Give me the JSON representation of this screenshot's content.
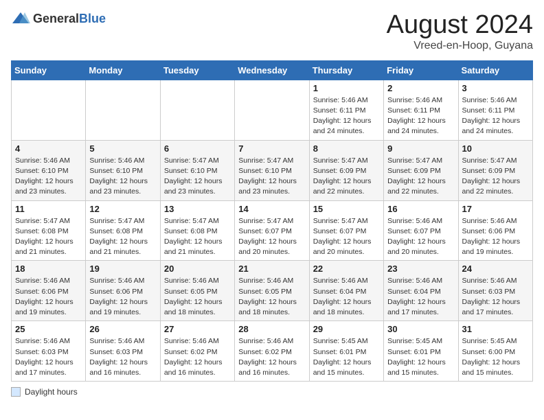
{
  "header": {
    "logo_general": "General",
    "logo_blue": "Blue",
    "month_year": "August 2024",
    "location": "Vreed-en-Hoop, Guyana"
  },
  "footer": {
    "daylight_label": "Daylight hours"
  },
  "days_of_week": [
    "Sunday",
    "Monday",
    "Tuesday",
    "Wednesday",
    "Thursday",
    "Friday",
    "Saturday"
  ],
  "weeks": [
    [
      {
        "day": "",
        "info": ""
      },
      {
        "day": "",
        "info": ""
      },
      {
        "day": "",
        "info": ""
      },
      {
        "day": "",
        "info": ""
      },
      {
        "day": "1",
        "info": "Sunrise: 5:46 AM\nSunset: 6:11 PM\nDaylight: 12 hours\nand 24 minutes."
      },
      {
        "day": "2",
        "info": "Sunrise: 5:46 AM\nSunset: 6:11 PM\nDaylight: 12 hours\nand 24 minutes."
      },
      {
        "day": "3",
        "info": "Sunrise: 5:46 AM\nSunset: 6:11 PM\nDaylight: 12 hours\nand 24 minutes."
      }
    ],
    [
      {
        "day": "4",
        "info": "Sunrise: 5:46 AM\nSunset: 6:10 PM\nDaylight: 12 hours\nand 23 minutes."
      },
      {
        "day": "5",
        "info": "Sunrise: 5:46 AM\nSunset: 6:10 PM\nDaylight: 12 hours\nand 23 minutes."
      },
      {
        "day": "6",
        "info": "Sunrise: 5:47 AM\nSunset: 6:10 PM\nDaylight: 12 hours\nand 23 minutes."
      },
      {
        "day": "7",
        "info": "Sunrise: 5:47 AM\nSunset: 6:10 PM\nDaylight: 12 hours\nand 23 minutes."
      },
      {
        "day": "8",
        "info": "Sunrise: 5:47 AM\nSunset: 6:09 PM\nDaylight: 12 hours\nand 22 minutes."
      },
      {
        "day": "9",
        "info": "Sunrise: 5:47 AM\nSunset: 6:09 PM\nDaylight: 12 hours\nand 22 minutes."
      },
      {
        "day": "10",
        "info": "Sunrise: 5:47 AM\nSunset: 6:09 PM\nDaylight: 12 hours\nand 22 minutes."
      }
    ],
    [
      {
        "day": "11",
        "info": "Sunrise: 5:47 AM\nSunset: 6:08 PM\nDaylight: 12 hours\nand 21 minutes."
      },
      {
        "day": "12",
        "info": "Sunrise: 5:47 AM\nSunset: 6:08 PM\nDaylight: 12 hours\nand 21 minutes."
      },
      {
        "day": "13",
        "info": "Sunrise: 5:47 AM\nSunset: 6:08 PM\nDaylight: 12 hours\nand 21 minutes."
      },
      {
        "day": "14",
        "info": "Sunrise: 5:47 AM\nSunset: 6:07 PM\nDaylight: 12 hours\nand 20 minutes."
      },
      {
        "day": "15",
        "info": "Sunrise: 5:47 AM\nSunset: 6:07 PM\nDaylight: 12 hours\nand 20 minutes."
      },
      {
        "day": "16",
        "info": "Sunrise: 5:46 AM\nSunset: 6:07 PM\nDaylight: 12 hours\nand 20 minutes."
      },
      {
        "day": "17",
        "info": "Sunrise: 5:46 AM\nSunset: 6:06 PM\nDaylight: 12 hours\nand 19 minutes."
      }
    ],
    [
      {
        "day": "18",
        "info": "Sunrise: 5:46 AM\nSunset: 6:06 PM\nDaylight: 12 hours\nand 19 minutes."
      },
      {
        "day": "19",
        "info": "Sunrise: 5:46 AM\nSunset: 6:06 PM\nDaylight: 12 hours\nand 19 minutes."
      },
      {
        "day": "20",
        "info": "Sunrise: 5:46 AM\nSunset: 6:05 PM\nDaylight: 12 hours\nand 18 minutes."
      },
      {
        "day": "21",
        "info": "Sunrise: 5:46 AM\nSunset: 6:05 PM\nDaylight: 12 hours\nand 18 minutes."
      },
      {
        "day": "22",
        "info": "Sunrise: 5:46 AM\nSunset: 6:04 PM\nDaylight: 12 hours\nand 18 minutes."
      },
      {
        "day": "23",
        "info": "Sunrise: 5:46 AM\nSunset: 6:04 PM\nDaylight: 12 hours\nand 17 minutes."
      },
      {
        "day": "24",
        "info": "Sunrise: 5:46 AM\nSunset: 6:03 PM\nDaylight: 12 hours\nand 17 minutes."
      }
    ],
    [
      {
        "day": "25",
        "info": "Sunrise: 5:46 AM\nSunset: 6:03 PM\nDaylight: 12 hours\nand 17 minutes."
      },
      {
        "day": "26",
        "info": "Sunrise: 5:46 AM\nSunset: 6:03 PM\nDaylight: 12 hours\nand 16 minutes."
      },
      {
        "day": "27",
        "info": "Sunrise: 5:46 AM\nSunset: 6:02 PM\nDaylight: 12 hours\nand 16 minutes."
      },
      {
        "day": "28",
        "info": "Sunrise: 5:46 AM\nSunset: 6:02 PM\nDaylight: 12 hours\nand 16 minutes."
      },
      {
        "day": "29",
        "info": "Sunrise: 5:45 AM\nSunset: 6:01 PM\nDaylight: 12 hours\nand 15 minutes."
      },
      {
        "day": "30",
        "info": "Sunrise: 5:45 AM\nSunset: 6:01 PM\nDaylight: 12 hours\nand 15 minutes."
      },
      {
        "day": "31",
        "info": "Sunrise: 5:45 AM\nSunset: 6:00 PM\nDaylight: 12 hours\nand 15 minutes."
      }
    ]
  ]
}
